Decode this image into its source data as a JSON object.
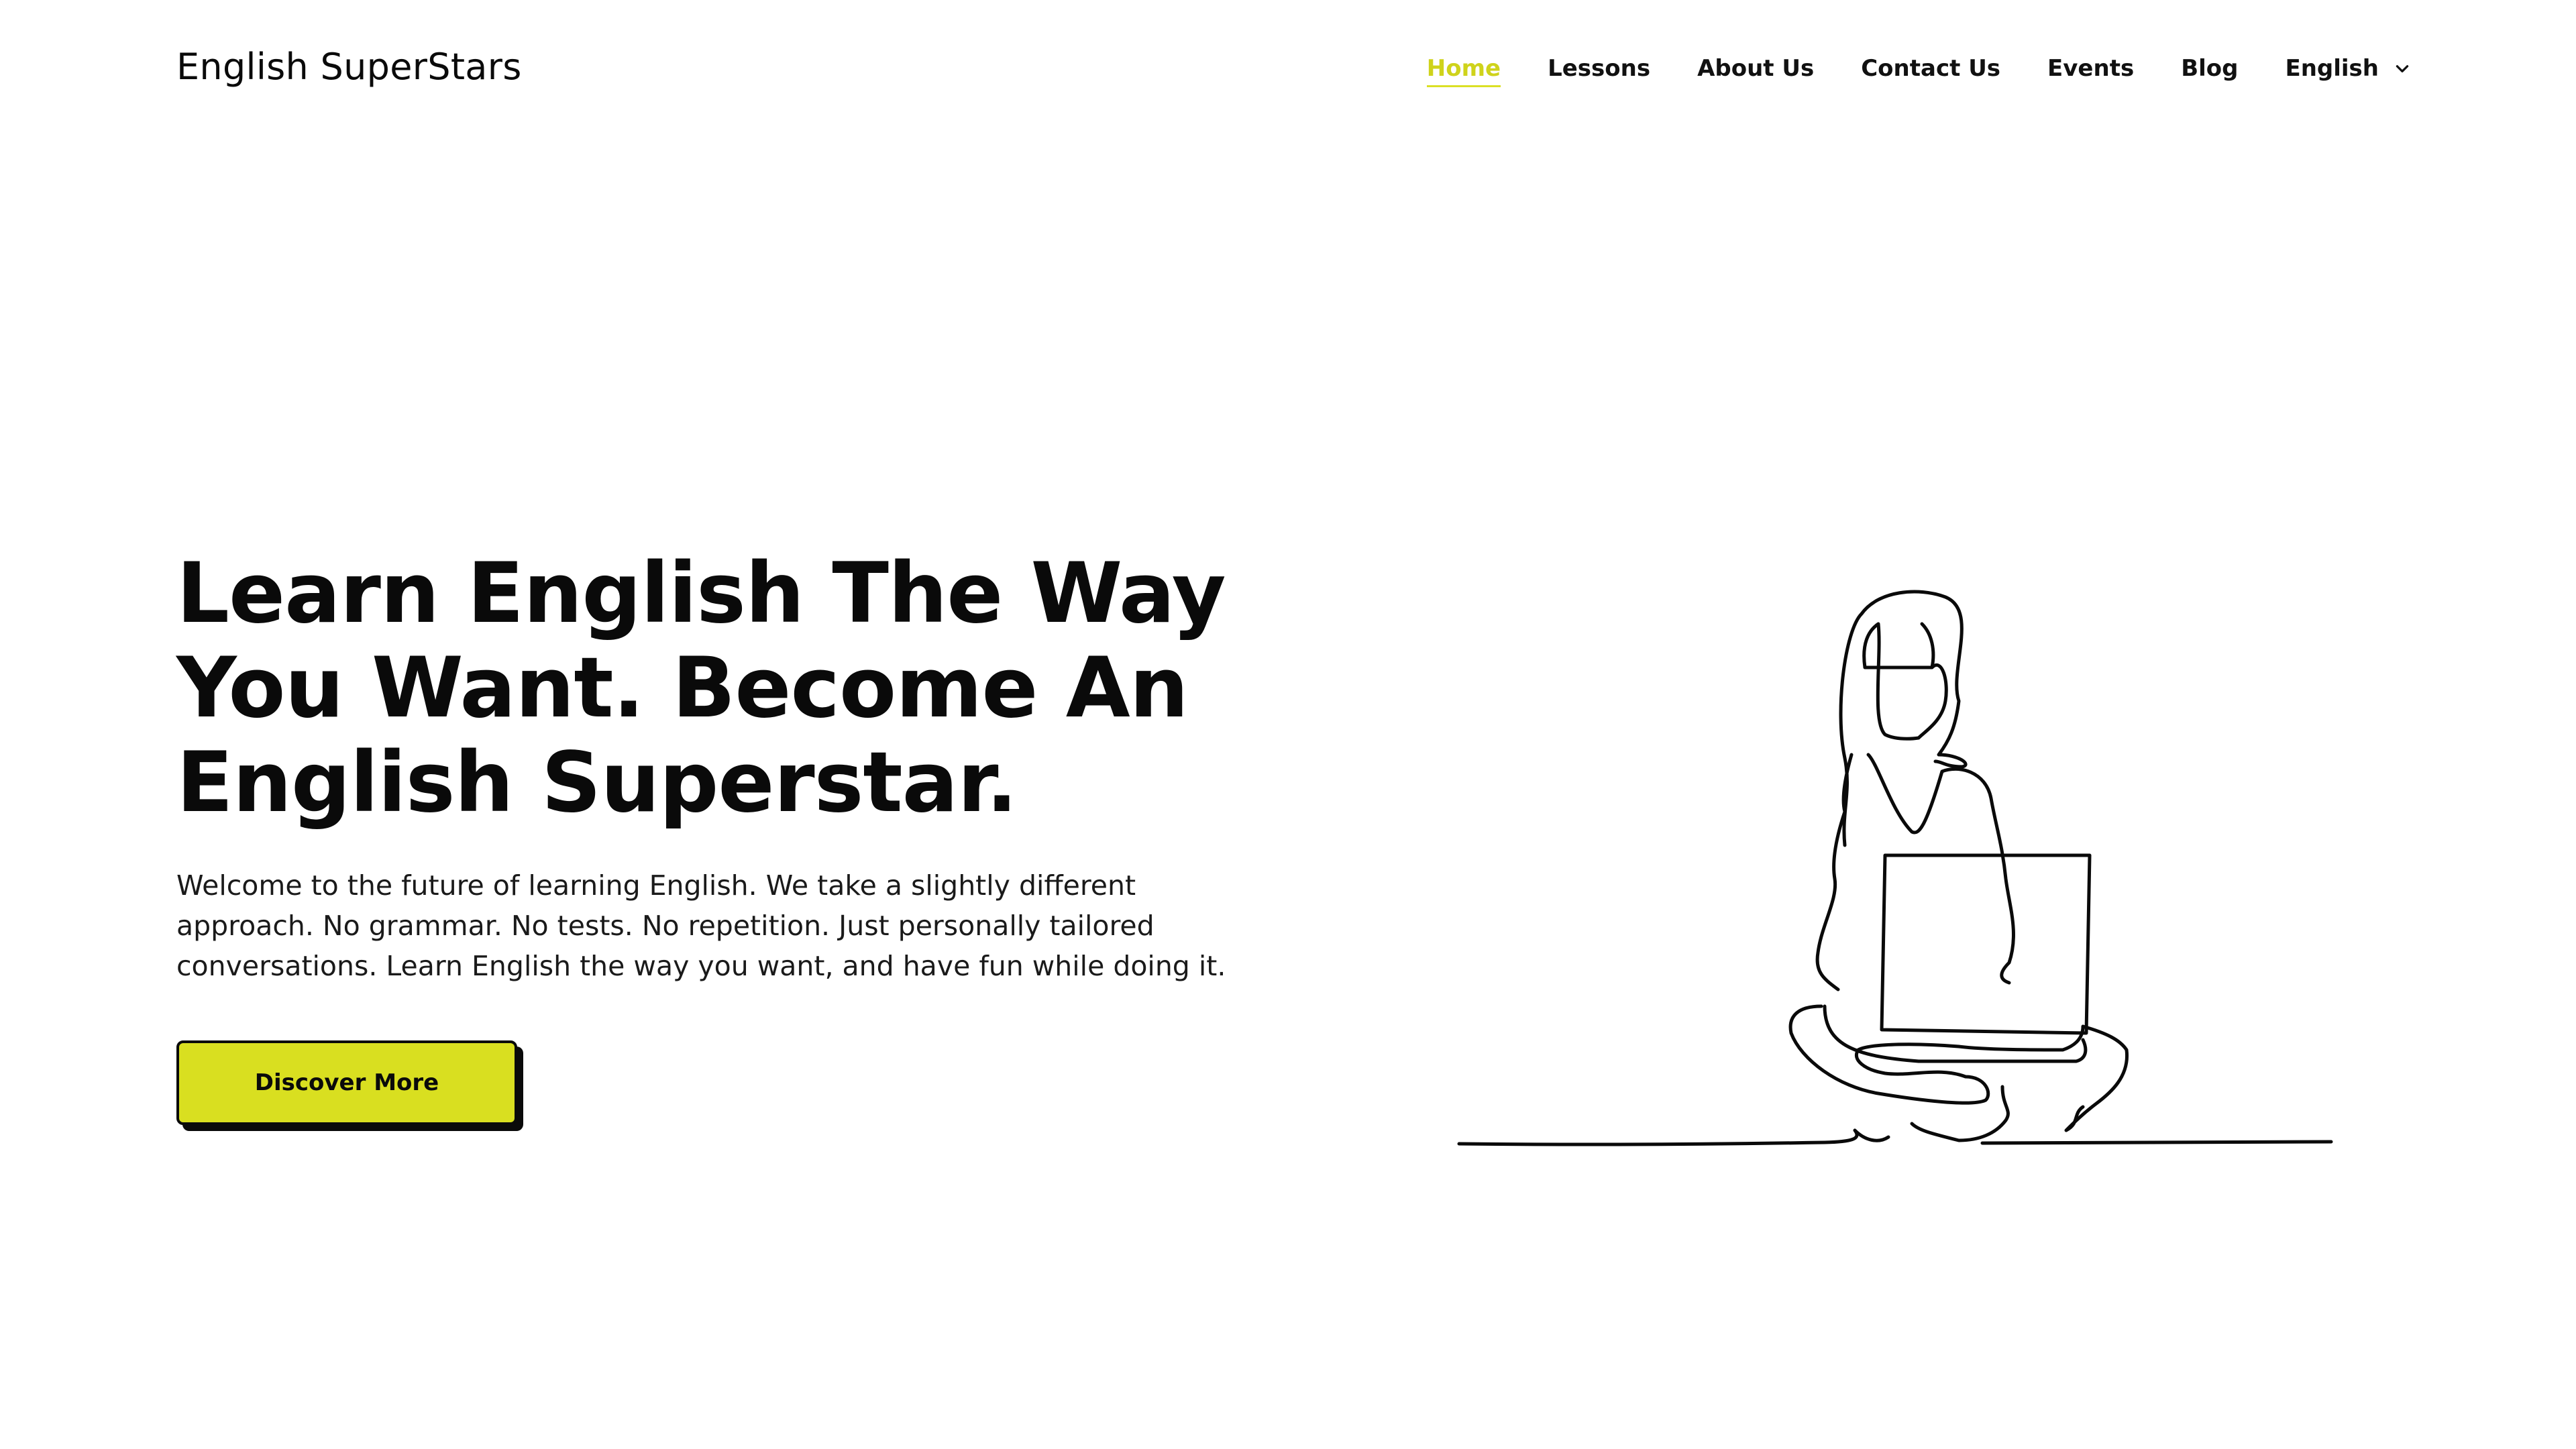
{
  "header": {
    "logo": "English SuperStars",
    "nav": [
      {
        "label": "Home",
        "active": true
      },
      {
        "label": "Lessons"
      },
      {
        "label": "About Us"
      },
      {
        "label": "Contact Us"
      },
      {
        "label": "Events"
      },
      {
        "label": "Blog"
      },
      {
        "label": "English",
        "dropdown": true
      }
    ]
  },
  "hero": {
    "title": "Learn English The Way You Want. Become An English Superstar.",
    "text": "Welcome to the future of learning English. We take a slightly different approach. No grammar. No tests. No repetition. Just personally tailored conversations. Learn English the way you want, and have fun while doing it.",
    "cta": "Discover More"
  },
  "colors": {
    "accent": "#d9df20",
    "text": "#0a0a0a",
    "background": "#ffffff"
  },
  "icons": {
    "language_dropdown": "chevron-down-icon",
    "illustration": "woman-with-laptop-line-art"
  }
}
